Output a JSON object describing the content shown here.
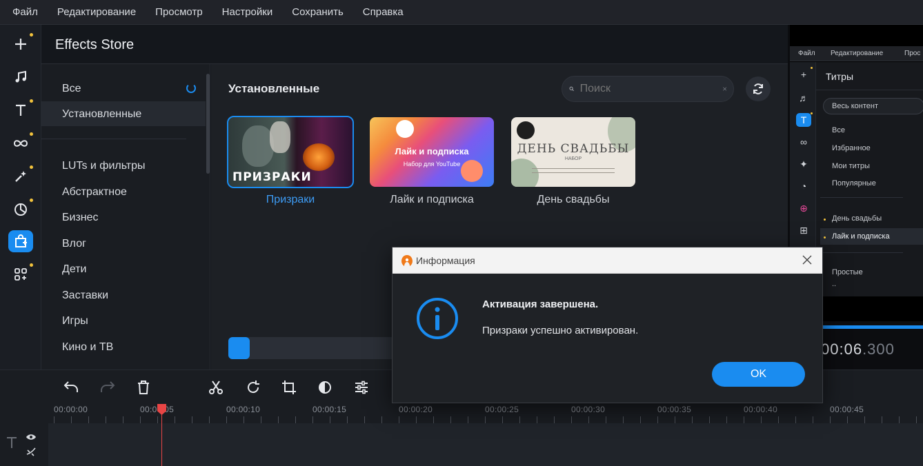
{
  "menu": [
    "Файл",
    "Редактирование",
    "Просмотр",
    "Настройки",
    "Сохранить",
    "Справка"
  ],
  "rail": {
    "tools": [
      {
        "icon": "plus-icon",
        "dot": true
      },
      {
        "icon": "music-note-icon",
        "dot": false
      },
      {
        "icon": "text-t-icon",
        "dot": true
      },
      {
        "icon": "transitions-infinity-icon",
        "dot": true
      },
      {
        "icon": "magic-wand-icon",
        "dot": true
      },
      {
        "icon": "clock-sticker-icon",
        "dot": true
      },
      {
        "icon": "effects-store-bag-icon",
        "dot": false,
        "active": true
      },
      {
        "icon": "more-tools-grid-icon",
        "dot": true
      }
    ]
  },
  "store": {
    "title": "Effects Store",
    "categories": [
      "Все",
      "Установленные",
      "LUTs и фильтры",
      "Абстрактное",
      "Бизнес",
      "Влог",
      "Дети",
      "Заставки",
      "Игры",
      "Кино и ТВ"
    ],
    "selected_category": "Установленные",
    "section_title": "Установленные",
    "search_placeholder": "Поиск",
    "cards": [
      {
        "label": "Призраки",
        "thumb_text": "ПРИЗРАКИ",
        "selected": true
      },
      {
        "label": "Лайк и подписка",
        "thumb_text": "Лайк и подписка",
        "thumb_sub": "Набор для YouTube",
        "selected": false
      },
      {
        "label": "День свадьбы",
        "thumb_text": "ДЕНЬ СВАДЬБЫ",
        "thumb_sub": "НАБОР",
        "selected": false
      }
    ],
    "progress_fraction": 0.04
  },
  "preview": {
    "menu": [
      "Файл",
      "Редактирование",
      "Прос"
    ],
    "title": "Титры",
    "select_value": "Весь контент",
    "items": [
      "Все",
      "Избранное",
      "Мои титры",
      "Популярные",
      "День свадьбы",
      "Лайк и подписка",
      "Простые",
      ".."
    ],
    "time_main": "00:06",
    "time_ms": ".300"
  },
  "timeline": {
    "ruler": [
      "00:00:00",
      "00:00:05",
      "00:00:10",
      "00:00:15",
      "00:00:20",
      "00:00:25",
      "00:00:30",
      "00:00:35",
      "00:00:40",
      "00:00:45"
    ]
  },
  "dialog": {
    "title": "Информация",
    "heading": "Активация завершена.",
    "message": "Призраки успешно активирован.",
    "ok": "OK"
  },
  "colors": {
    "accent": "#1a8cf0",
    "dot": "#f2c23c",
    "playhead": "#e84545"
  }
}
